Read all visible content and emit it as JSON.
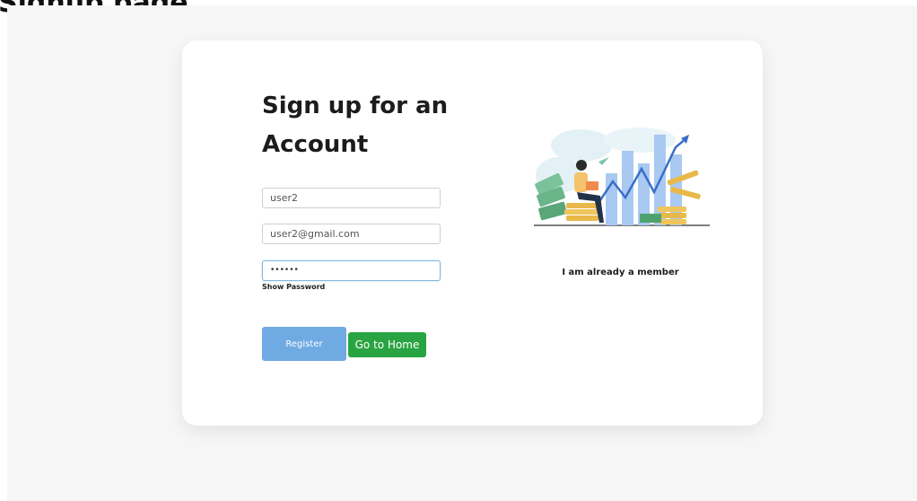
{
  "page": {
    "heading": "Signup page"
  },
  "form": {
    "title": "Sign up for an Account",
    "username_value": "user2",
    "email_value": "user2@gmail.com",
    "password_value": "••••••",
    "show_password_label": "Show Password",
    "register_label": "Register",
    "home_label": "Go to Home"
  },
  "side": {
    "member_link": "I am already a member",
    "illustration_icon": "finance-growth-illustration"
  },
  "colors": {
    "register_button": "#6faae3",
    "home_button": "#2aa442",
    "backdrop": "#f6f6f6",
    "focus_border": "#7fb7dd"
  }
}
